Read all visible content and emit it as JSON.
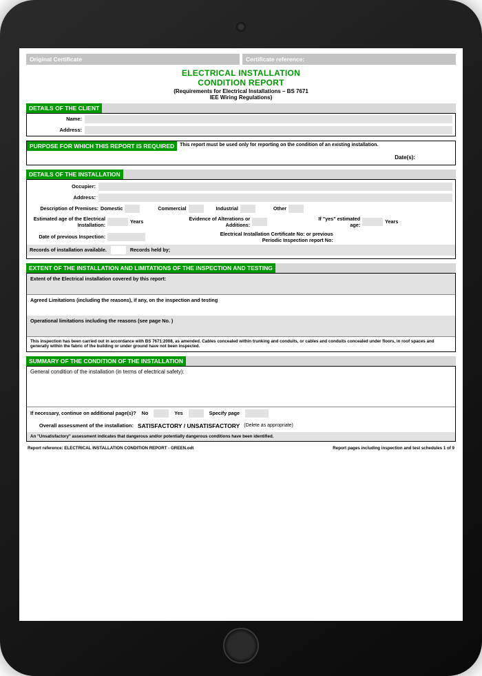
{
  "top": {
    "orig_cert": "Original Certificate",
    "cert_ref": "Certificate reference:"
  },
  "title": {
    "line1": "ELECTRICAL INSTALLATION",
    "line2": "CONDITION REPORT",
    "req1": "(Requirements for Electrical Installations – BS 7671",
    "req2": "IEE Wiring Regulations)"
  },
  "client": {
    "header": "DETAILS OF THE CLIENT",
    "name_lbl": "Name:",
    "addr_lbl": "Address:"
  },
  "purpose": {
    "header": "PURPOSE FOR WHICH THIS REPORT IS REQUIRED",
    "note": "This report must be used only for reporting on the condition of an existing installation.",
    "dates_lbl": "Date(s):"
  },
  "install": {
    "header": "DETAILS OF THE INSTALLATION",
    "occupier": "Occupier:",
    "address": "Address:",
    "desc": "Description of Premises:",
    "domestic": "Domestic",
    "commercial": "Commercial",
    "industrial": "Industrial",
    "other": "Other",
    "age_lbl": "Estimated age of the Electrical Installation:",
    "years": "Years",
    "alterations": "Evidence of Alterations or Additions:",
    "ifyes": "If \"yes\" estimated age:",
    "prev_date": "Date of previous  Inspection:",
    "cert_no": "Electrical Installation Certificate No: or previous Periodic Inspection report No:",
    "records": "Records of installation available.",
    "held_by": "Records held by;"
  },
  "extent": {
    "header": "EXTENT OF THE INSTALLATION AND LIMITATIONS OF THE INSPECTION AND TESTING",
    "q1": "Extent of the Electrical installation covered by this report:",
    "q2": "Agreed Limitations (including the reasons), if any, on the inspection and testing",
    "q3": "Operational limitations including the reasons (see page No.       )",
    "note": "This inspection has been carried out in accordance with BS 7671:2008, as amended. Cables concealed within trunking and conduits, or cables and conduits concealed under floors, in roof spaces and generally within the fabric of the building or under ground have not been inspected."
  },
  "summary": {
    "header": "SUMMARY OF THE CONDITION OF THE INSTALLATION",
    "general": "General condition of the installation (in terms of electrical safety):",
    "addl": "If necessary, continue on additional page(s)?",
    "no": "No",
    "yes": "Yes",
    "specify": "Specify page",
    "assess_lbl": "Overall assessment of the installation:",
    "assess_val": "SATISFACTORY / UNSATISFACTORY",
    "delete": "(Delete as appropriate)",
    "unsat_note": "An \"Unsatisfactory\" assessment indicates that dangerous and/or potentially dangerous conditions have been identified."
  },
  "footer": {
    "left": "Report reference: ELECTRICAL INSTALLATION CONDITION REPORT - GREEN.odt",
    "right": "Report pages including inspection and test schedules 1 of 9"
  }
}
